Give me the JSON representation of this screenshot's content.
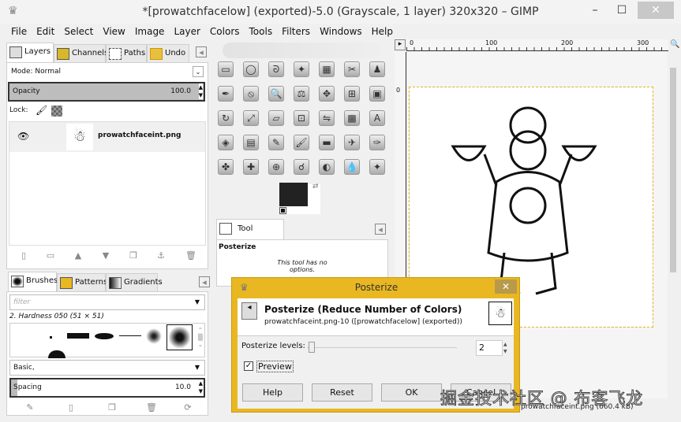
{
  "window": {
    "title": "*[prowatchfacelow] (exported)-5.0 (Grayscale, 1 layer) 320x320 – GIMP",
    "min": "–",
    "max": "☐",
    "close": "✕"
  },
  "menu": [
    "File",
    "Edit",
    "Select",
    "View",
    "Image",
    "Layer",
    "Colors",
    "Tools",
    "Filters",
    "Windows",
    "Help"
  ],
  "layers_dock": {
    "tabs": [
      "Layers",
      "Channels",
      "Paths",
      "Undo"
    ],
    "mode": "Mode: Normal",
    "opacity_label": "Opacity",
    "opacity_value": "100.0",
    "lock_label": "Lock:",
    "layer_name": "prowatchfaceint.png"
  },
  "brushes_dock": {
    "tabs": [
      "Brushes",
      "Patterns",
      "Gradients"
    ],
    "filter_placeholder": "filter",
    "brush_label": "2. Hardness 050 (51 × 51)",
    "preset": "Basic,",
    "spacing_label": "Spacing",
    "spacing_value": "10.0"
  },
  "toolbox": {
    "icons": [
      "rect-select-icon",
      "ellipse-select-icon",
      "lasso-icon",
      "fuzzy-select-icon",
      "color-select-icon",
      "scissors-icon",
      "foreground-select-icon",
      "paths-icon",
      "color-picker-icon",
      "zoom-icon",
      "measure-icon",
      "move-icon",
      "align-icon",
      "crop-icon",
      "rotate-icon",
      "scale-icon",
      "shear-icon",
      "perspective-icon",
      "flip-icon",
      "cage-icon",
      "text-icon",
      "bucket-fill-icon",
      "blend-icon",
      "pencil-icon",
      "paintbrush-icon",
      "eraser-icon",
      "airbrush-icon",
      "ink-icon",
      "myPaint-icon",
      "heal-icon",
      "clone-icon",
      "smudge-icon",
      "dodge-burn-icon",
      "blur-icon",
      "convolve-icon"
    ],
    "tool_options_tab": "Tool Options",
    "tool_name": "Posterize",
    "no_options": "This tool has no options."
  },
  "canvas": {
    "ruler_ticks": [
      "0",
      "100",
      "200",
      "300"
    ],
    "vruler_label": "0",
    "status": "prowatchfaceint.png (660.4 kB)"
  },
  "dialog": {
    "title": "Posterize",
    "heading": "Posterize (Reduce Number of Colors)",
    "subtitle": "prowatchfaceint.png-10 ([prowatchfacelow] (exported))",
    "levels_label": "Posterize levels:",
    "levels_value": "2",
    "preview_label": "Preview",
    "buttons": [
      "Help",
      "Reset",
      "OK",
      "Cancel"
    ],
    "accent": "#e9b721"
  },
  "watermark": "掘金技术社区 @ 布客飞龙"
}
